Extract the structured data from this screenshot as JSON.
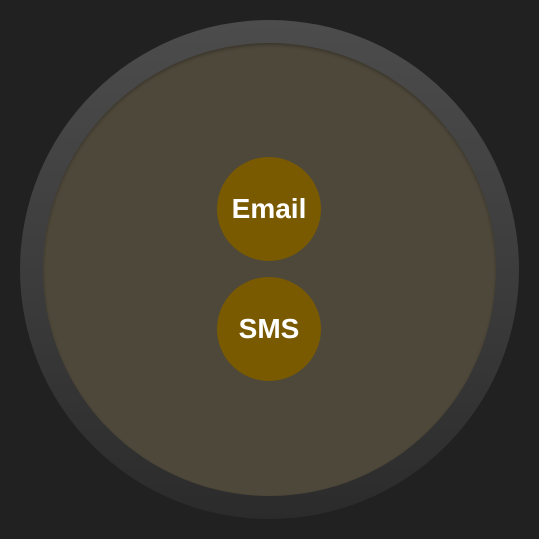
{
  "colors": {
    "background": "#212121",
    "bezel": "#444444",
    "screen": "#4e483a",
    "button": "#7a5a00",
    "button_text": "#ffffff"
  },
  "actions": [
    {
      "label": "Email"
    },
    {
      "label": "SMS"
    }
  ]
}
